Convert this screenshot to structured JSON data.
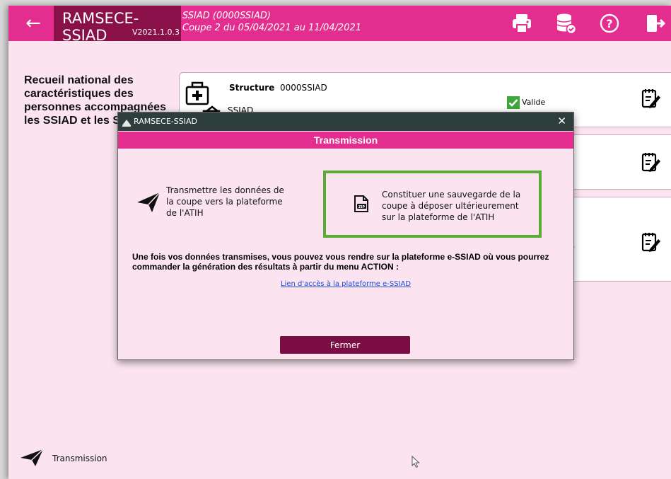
{
  "header": {
    "app_name": "RAMSECE-SSIAD",
    "version": "V2021.1.0.3",
    "entity": "SSIAD (0000SSIAD)",
    "period": "Coupe 2 du 05/04/2021 au 11/04/2021",
    "back_icon": "arrow-left-icon",
    "actions": [
      "printer-icon",
      "database-check-icon",
      "help-icon",
      "logout-icon"
    ]
  },
  "left_panel": {
    "title": "Recueil national des caractéristiques des personnes accompagnées les SSIAD et les SPASAD"
  },
  "cards": {
    "card1": {
      "label": "Structure",
      "code": "0000SSIAD",
      "type": "SSIAD",
      "status": "Valide"
    },
    "card3": {
      "fragment": ")"
    }
  },
  "bottom": {
    "transmission_label": "Transmission"
  },
  "dialog": {
    "window_title": "RAMSECE-SSIAD",
    "close_symbol": "✕",
    "header": "Transmission",
    "option1": {
      "line1": "Transmettre les données de",
      "line2": "la coupe vers la plateforme",
      "line3": "de l'ATIH"
    },
    "option2": {
      "line1": "Constituer une sauvegarde de la",
      "line2": "coupe à déposer ultérieurement",
      "line3": "sur la plateforme de l'ATIH"
    },
    "info": "Une fois vos données transmises, vous pouvez vous rendre sur la plateforme e-SSIAD où vous pourrez commander la génération des résultats à partir du menu ACTION :",
    "link": "Lien d'accès à la plateforme e-SSIAD",
    "close_button": "Fermer"
  },
  "colors": {
    "header_pink": "#e42e8f",
    "brand_dark": "#8a1049",
    "dialog_titlebar": "#2d3e3d",
    "button_dark": "#7a0d43",
    "highlight_green": "#5aaa36",
    "background": "#fbe4ef"
  }
}
